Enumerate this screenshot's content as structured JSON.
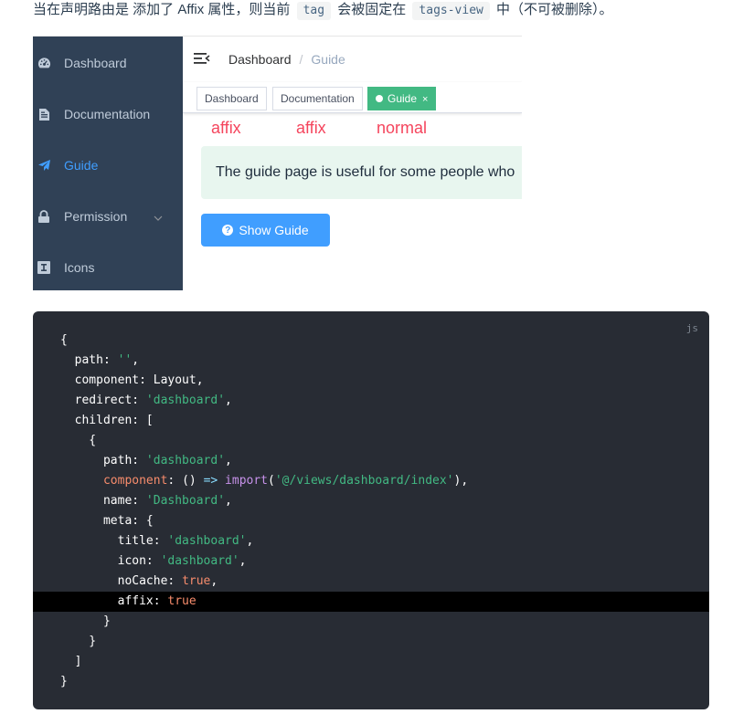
{
  "intro": {
    "part1": "当在声明路由是 添加了 Affix 属性，则当前",
    "code1": "tag",
    "part2": "会被固定在",
    "code2": "tags-view",
    "part3": "中（不可被删除）。"
  },
  "sidebar": {
    "background": "#304156",
    "items": [
      {
        "label": "Dashboard",
        "icon": "dashboard-icon"
      },
      {
        "label": "Documentation",
        "icon": "document-icon"
      },
      {
        "label": "Guide",
        "icon": "paper-plane-icon",
        "active": true
      },
      {
        "label": "Permission",
        "icon": "lock-icon",
        "has_submenu": true
      },
      {
        "label": "Icons",
        "icon": "icon-glyph-icon"
      }
    ]
  },
  "navbar": {
    "breadcrumb": [
      "Dashboard",
      "Guide"
    ],
    "separator": "/"
  },
  "tags": [
    {
      "label": "Dashboard"
    },
    {
      "label": "Documentation"
    },
    {
      "label": "Guide",
      "active": true,
      "close": "×"
    }
  ],
  "annotations": [
    "affix",
    "affix",
    "normal"
  ],
  "tip_text": "The guide page is useful for some people who",
  "show_guide_button": {
    "label": "Show Guide",
    "icon": "question-circle-icon"
  },
  "code": {
    "lang": "js",
    "highlight_line": 13,
    "lines": [
      "{",
      "  path: '',",
      "  component: Layout,",
      "  redirect: 'dashboard',",
      "  children: [",
      "    {",
      "      path: 'dashboard',",
      "      component: () => import('@/views/dashboard/index'),",
      "      name: 'Dashboard',",
      "      meta: {",
      "        title: 'dashboard',",
      "        icon: 'dashboard',",
      "        noCache: true,",
      "        affix: true",
      "      }",
      "    }",
      "  ]",
      "}"
    ]
  },
  "colors": {
    "accent": "#409eff",
    "tag_active": "#42b983",
    "annotation": "#f5455d",
    "code_bg": "#282c34"
  }
}
